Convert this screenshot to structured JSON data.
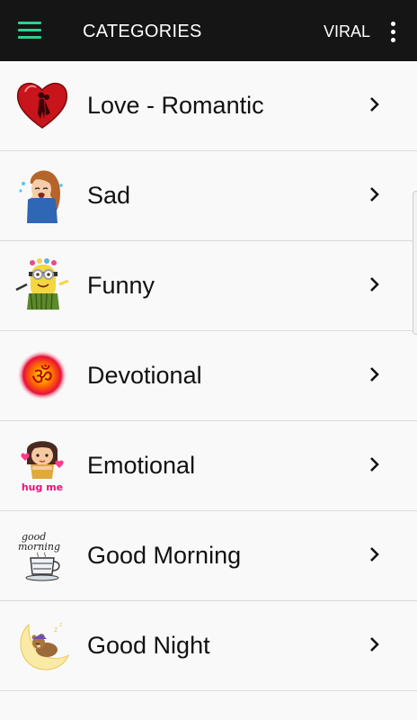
{
  "appbar": {
    "title": "CATEGORIES",
    "viral_label": "VIRAL",
    "menu_icon": "hamburger-menu-icon",
    "overflow_icon": "more-vert-icon",
    "accent": "#2fd08f",
    "background": "#151515"
  },
  "categories": [
    {
      "label": "Love - Romantic",
      "icon": "heart-couple-icon"
    },
    {
      "label": "Sad",
      "icon": "crying-girl-icon"
    },
    {
      "label": "Funny",
      "icon": "minion-icon"
    },
    {
      "label": "Devotional",
      "icon": "om-symbol-icon"
    },
    {
      "label": "Emotional",
      "icon": "hug-me-girl-icon"
    },
    {
      "label": "Good Morning",
      "icon": "good-morning-cup-icon"
    },
    {
      "label": "Good Night",
      "icon": "teddy-moon-icon"
    }
  ]
}
